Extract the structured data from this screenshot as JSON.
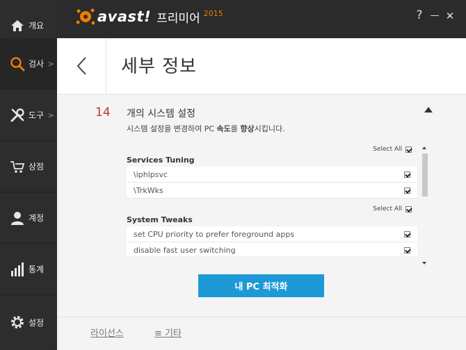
{
  "app": {
    "brand": "avast!",
    "product": "프리미어",
    "year": "2015",
    "help": "?",
    "minimize": "—",
    "close": "✕"
  },
  "sidebar": {
    "items": [
      {
        "label": "개요",
        "icon": "home-icon"
      },
      {
        "label": "검사",
        "icon": "search-icon",
        "chevron": ">"
      },
      {
        "label": "도구",
        "icon": "tools-icon",
        "chevron": ">"
      },
      {
        "label": "상점",
        "icon": "cart-icon"
      },
      {
        "label": "계정",
        "icon": "user-icon"
      },
      {
        "label": "통계",
        "icon": "stats-icon"
      },
      {
        "label": "설정",
        "icon": "gear-icon"
      }
    ]
  },
  "header": {
    "title": "세부 정보"
  },
  "item": {
    "number": "14",
    "title": "개의 시스템 설정",
    "desc_prefix": "시스템 설정을 변경하여 PC ",
    "desc_bold1": "속도",
    "desc_mid": "를 ",
    "desc_bold2": "향상",
    "desc_suffix": "시킵니다."
  },
  "sections": [
    {
      "title": "Services Tuning",
      "select_all": "Select All",
      "rows": [
        "\\iphlpsvc",
        "\\TrkWks"
      ]
    },
    {
      "title": "System Tweaks",
      "select_all": "Select All",
      "rows": [
        "set CPU priority to prefer foreground apps",
        "disable fast user switching"
      ]
    }
  ],
  "optimize_button": "내 PC 최적화",
  "footer": {
    "license": "라이선스",
    "other": "≡ 기타"
  },
  "colors": {
    "accent": "#1d9ad6",
    "brand_orange": "#f07c00",
    "number_red": "#c0392b"
  }
}
